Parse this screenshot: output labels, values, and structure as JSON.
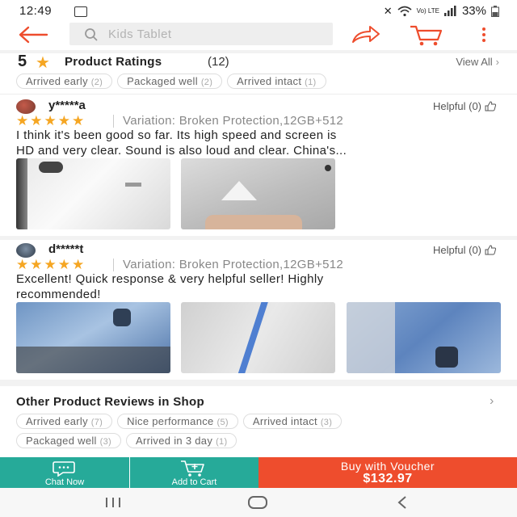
{
  "status_bar": {
    "time": "12:49",
    "battery": "33%",
    "network": "Vo) LTE"
  },
  "search": {
    "placeholder": "Kids Tablet"
  },
  "ratings": {
    "score": "5",
    "title": "Product Ratings",
    "count": "(12)",
    "view_all": "View All",
    "tags": [
      {
        "label": "Arrived early",
        "count": "(2)"
      },
      {
        "label": "Packaged well",
        "count": "(2)"
      },
      {
        "label": "Arrived intact",
        "count": "(1)"
      }
    ]
  },
  "reviews": [
    {
      "user": "y*****a",
      "helpful": "Helpful (0)",
      "variation": "Variation: Broken Protection,12GB+512",
      "text_line1": "I think it's been good so far. Its high speed and screen is",
      "text_line2": "HD and very clear. Sound is also loud and clear. China's..."
    },
    {
      "user": "d*****t",
      "helpful": "Helpful (0)",
      "variation": "Variation: Broken Protection,12GB+512",
      "text_line1": "Excellent! Quick response & very helpful seller! Highly",
      "text_line2": "recommended!"
    }
  ],
  "shop_reviews": {
    "title": "Other Product Reviews in Shop",
    "tags": [
      {
        "label": "Arrived early",
        "count": "(7)"
      },
      {
        "label": "Nice performance",
        "count": "(5)"
      },
      {
        "label": "Arrived intact",
        "count": "(3)"
      },
      {
        "label": "Packaged well",
        "count": "(3)"
      },
      {
        "label": "Arrived in 3 day",
        "count": "(1)"
      }
    ]
  },
  "bottom_bar": {
    "chat_label": "Chat Now",
    "cart_label": "Add to Cart",
    "buy_label": "Buy with Voucher",
    "price": "$132.97",
    "colors": {
      "teal": "#26aa99",
      "orange": "#ee4d2d"
    }
  },
  "colors": {
    "accent": "#ee4d2d",
    "star": "#f5a623"
  }
}
